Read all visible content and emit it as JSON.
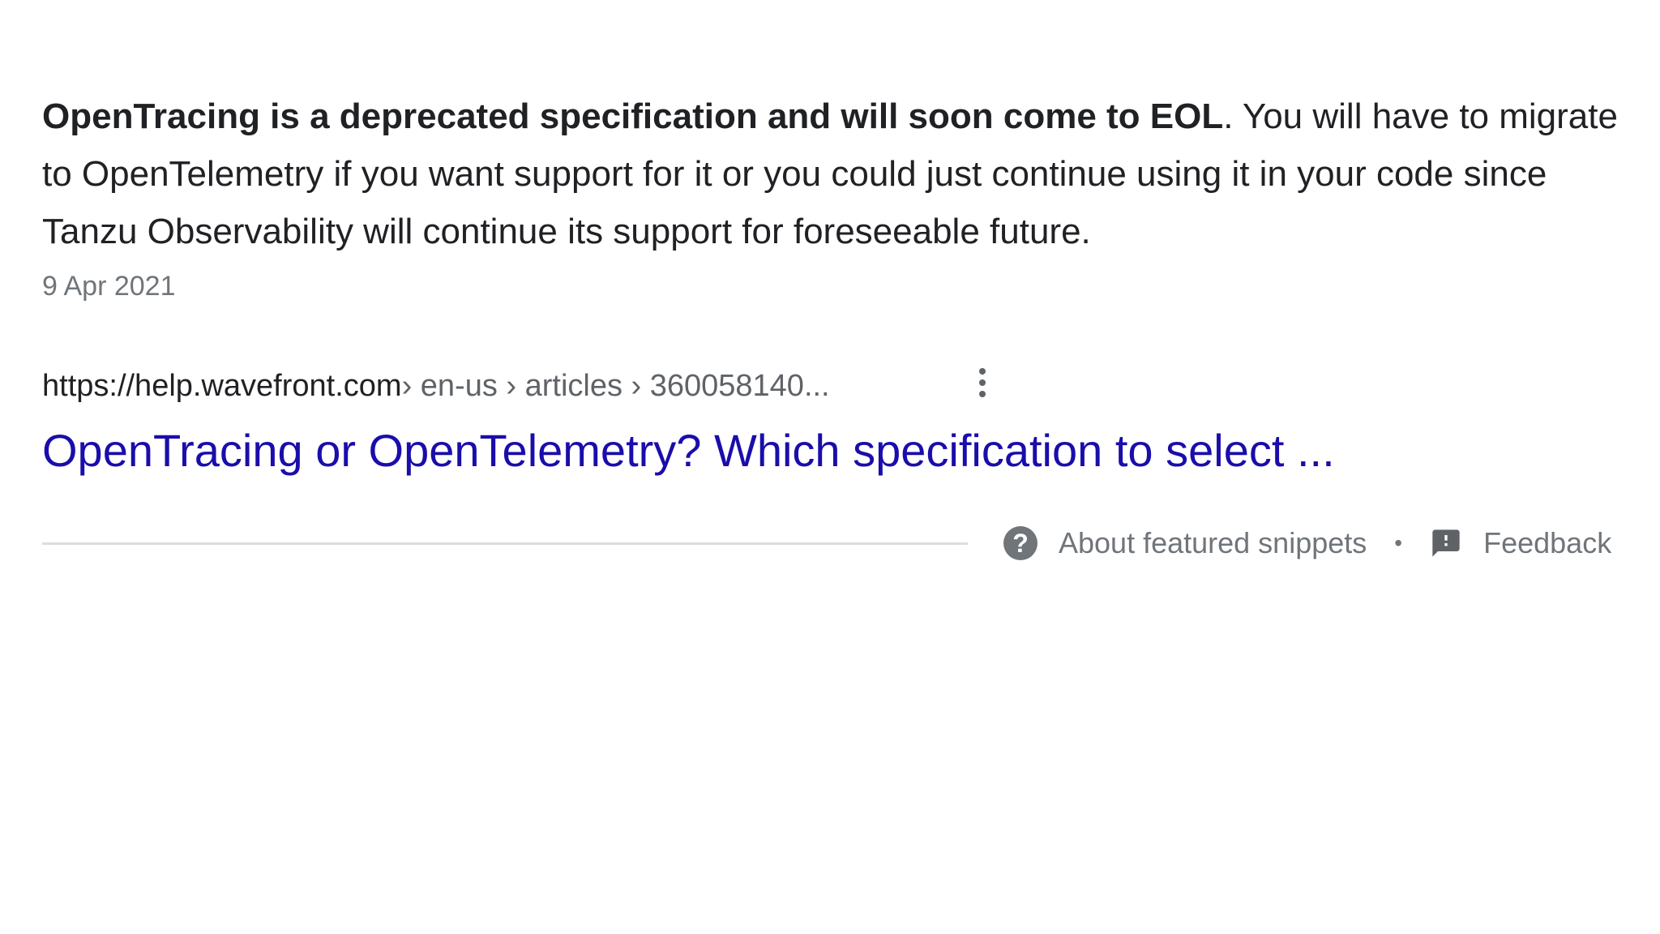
{
  "snippet": {
    "bold_text": "OpenTracing is a deprecated specification and will soon come to EOL",
    "rest_text": ". You will have to migrate to OpenTelemetry if you want support for it or you could just continue using it in your code since Tanzu Observability will continue its support for foreseeable future.",
    "date": "9 Apr 2021"
  },
  "result": {
    "domain": "https://help.wavefront.com",
    "path": " › en-us › articles › 360058140...",
    "title": "OpenTracing or OpenTelemetry? Which specification to select ..."
  },
  "footer": {
    "about_label": "About featured snippets",
    "separator": "•",
    "feedback_label": "Feedback"
  },
  "icons": {
    "about": "help-circle-icon",
    "feedback": "feedback-icon",
    "menu": "more-vert-icon"
  },
  "colors": {
    "link": "#1a0dab",
    "text": "#202124",
    "muted": "#70757a",
    "divider": "#dadce0"
  }
}
